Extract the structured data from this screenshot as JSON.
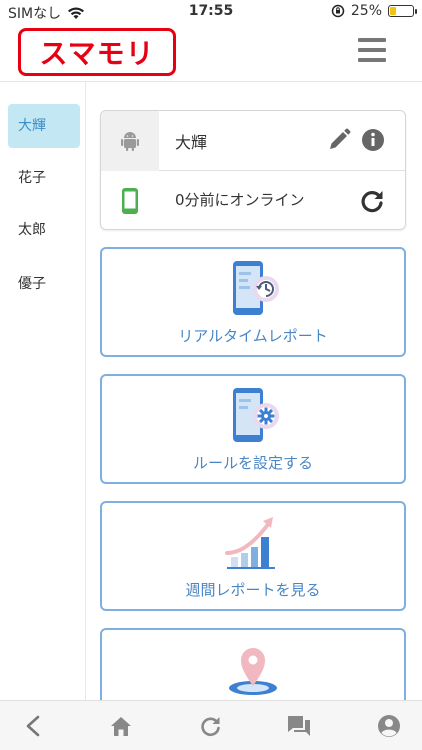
{
  "status_bar": {
    "carrier": "SIMなし",
    "time": "17:55",
    "battery": "25%",
    "battery_level": 0.25
  },
  "header": {
    "logo_text": "スマモリ",
    "menu_icon": "hamburger-menu-icon"
  },
  "sidebar": {
    "items": [
      {
        "label": "大輝",
        "active": true
      },
      {
        "label": "花子",
        "active": false
      },
      {
        "label": "太郎",
        "active": false
      },
      {
        "label": "優子",
        "active": false
      }
    ]
  },
  "device": {
    "name": "大輝",
    "os_icon": "android-icon",
    "status": "0分前にオンライン"
  },
  "features": [
    {
      "label": "リアルタイムレポート",
      "icon": "realtime-report-icon"
    },
    {
      "label": "ルールを設定する",
      "icon": "rule-settings-icon"
    },
    {
      "label": "週間レポートを見る",
      "icon": "weekly-report-icon"
    },
    {
      "label": "",
      "icon": "location-pin-icon"
    }
  ],
  "bottom_nav": [
    "back-icon",
    "home-icon",
    "reload-icon",
    "chat-icon",
    "account-icon"
  ],
  "colors": {
    "brand_red": "#e60012",
    "accent_blue": "#4a86c5",
    "active_bg": "#c4e8f3",
    "online_green": "#4caf50"
  }
}
